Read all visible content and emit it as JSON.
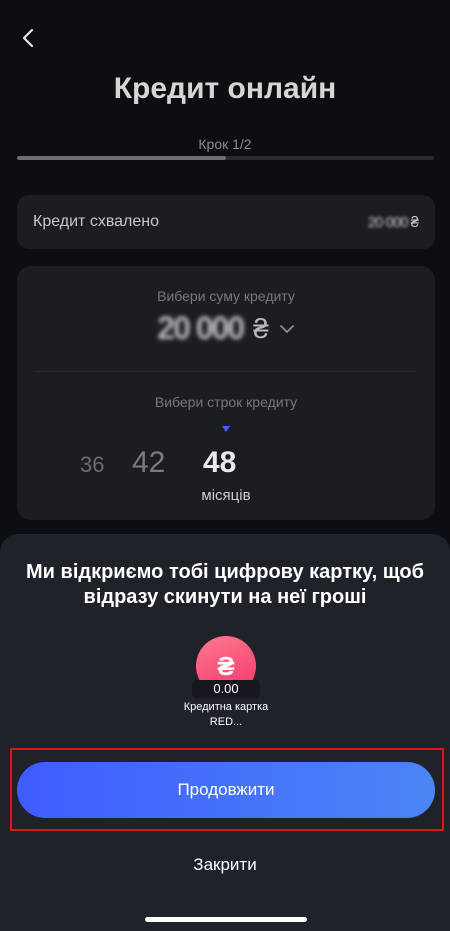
{
  "header": {
    "title": "Кредит онлайн",
    "step": "Крок 1/2",
    "progress_fraction": 0.5
  },
  "approved": {
    "label": "Кредит схвалено",
    "amount": "20 000",
    "currency": "₴"
  },
  "amount_picker": {
    "label": "Вибери суму кредиту",
    "value": "20 000",
    "currency": "₴"
  },
  "term_picker": {
    "label": "Вибери строк кредиту",
    "options": [
      "36",
      "42",
      "48"
    ],
    "selected": "48",
    "unit": "місяців"
  },
  "sheet": {
    "title": "Ми відкриємо тобі цифрову картку, щоб відразу скинути на неї гроші",
    "card": {
      "currency_symbol": "₴",
      "balance": "0.00",
      "name": "Кредитна картка RED..."
    },
    "continue_label": "Продовжити",
    "close_label": "Закрити"
  },
  "colors": {
    "accent": "#3f5cff",
    "badge": "#f0346a",
    "highlight": "#e0141b"
  },
  "icons": {
    "back": "chevron-left-icon",
    "dropdown": "chevron-down-icon",
    "term_pointer": "triangle-down-icon"
  }
}
